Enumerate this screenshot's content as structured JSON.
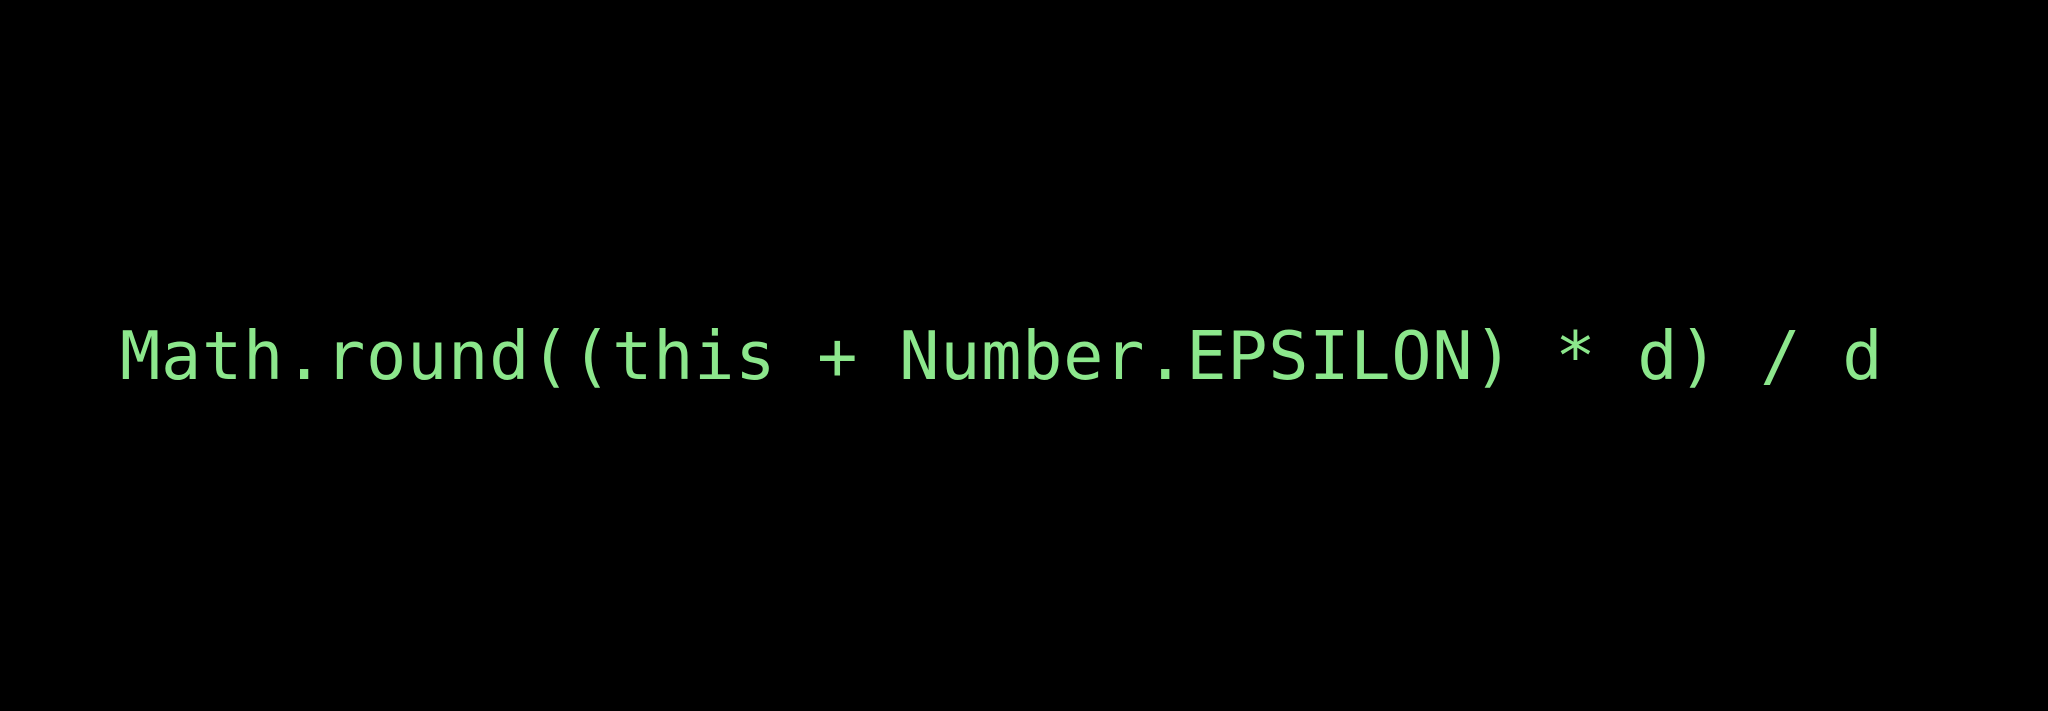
{
  "terminal": {
    "line": "Math.round((this + Number.EPSILON) * d) / d"
  }
}
